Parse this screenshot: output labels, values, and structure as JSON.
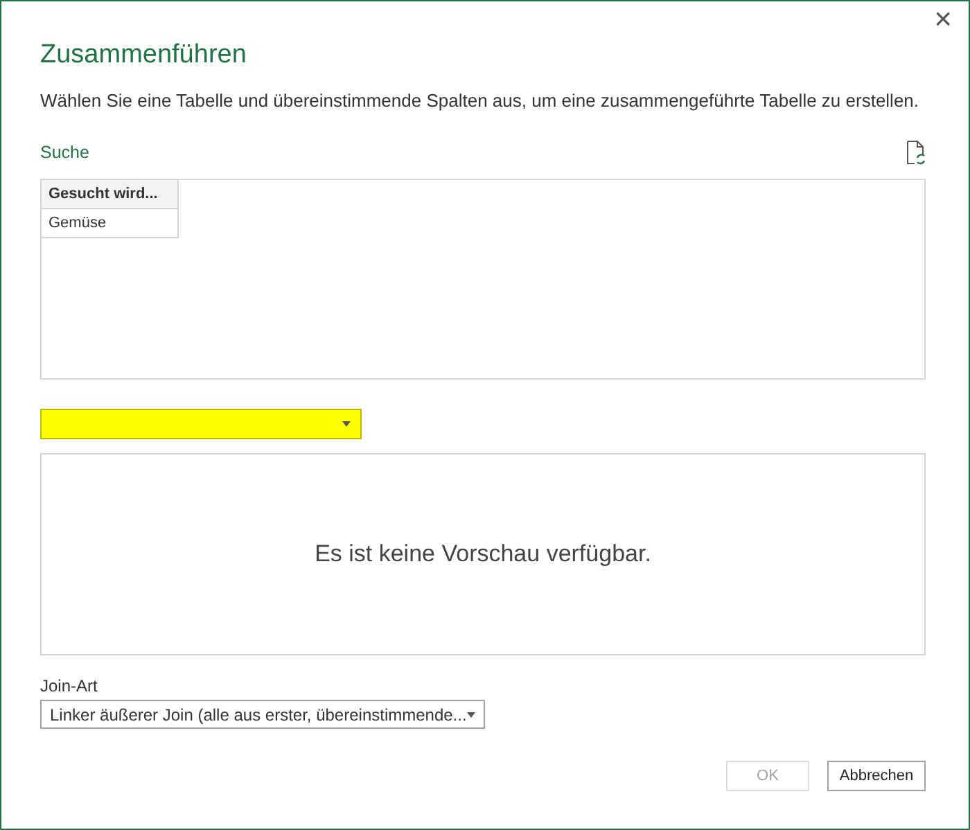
{
  "window": {
    "title": "Zusammenführen",
    "close": "×"
  },
  "description": "Wählen Sie eine Tabelle und übereinstimmende Spalten aus, um eine zusammengeführte Tabelle zu erstellen.",
  "first_table": {
    "label": "Suche",
    "columns": [
      "Gesucht wird..."
    ],
    "rows": [
      [
        "Gemüse"
      ]
    ]
  },
  "second_table": {
    "selector": {
      "highlighted": true
    },
    "preview_message": "Es ist keine Vorschau verfügbar."
  },
  "join_kind": {
    "label": "Join-Art",
    "value": "Linker äußerer Join (alle aus erster, übereinstimmende..."
  },
  "buttons": [
    {
      "label": "OK",
      "disabled": true
    },
    {
      "label": "Abbrechen",
      "disabled": false
    }
  ]
}
